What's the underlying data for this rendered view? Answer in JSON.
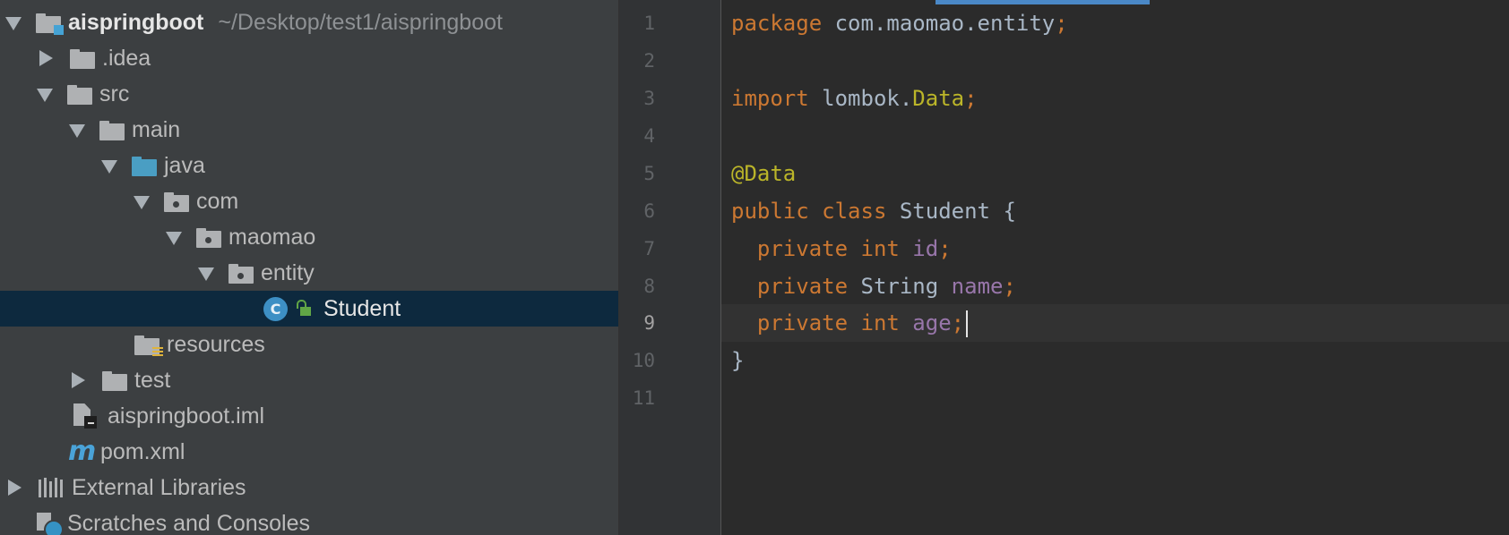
{
  "project_tree": {
    "root": {
      "label": "aispringboot",
      "path": "~/Desktop/test1/aispringboot"
    },
    "items": [
      {
        "label": ".idea"
      },
      {
        "label": "src"
      },
      {
        "label": "main"
      },
      {
        "label": "java"
      },
      {
        "label": "com"
      },
      {
        "label": "maomao"
      },
      {
        "label": "entity"
      },
      {
        "label": "Student",
        "selected": true,
        "class_icon_letter": "C"
      },
      {
        "label": "resources"
      },
      {
        "label": "test"
      },
      {
        "label": "aispringboot.iml"
      },
      {
        "label": "pom.xml",
        "icon_glyph": "m"
      },
      {
        "label": "External Libraries"
      },
      {
        "label": "Scratches and Consoles"
      }
    ]
  },
  "editor": {
    "current_line": 9,
    "line_numbers": [
      "1",
      "2",
      "3",
      "4",
      "5",
      "6",
      "7",
      "8",
      "9",
      "10",
      "11"
    ],
    "tokens": {
      "l1_kw": "package",
      "l1_rest": " com.maomao.entity",
      "l1_semi": ";",
      "l3_kw": "import",
      "l3_rest": " lombok.",
      "l3_ann": "Data",
      "l3_semi": ";",
      "l5_ann": "@Data",
      "l6_kw1": "public",
      "l6_kw2": " class",
      "l6_rest": " Student {",
      "l7_kw1": "private",
      "l7_kw2": " int",
      "l7_fld": " id",
      "l7_semi": ";",
      "l8_kw1": "private",
      "l8_type": " String",
      "l8_fld": " name",
      "l8_semi": ";",
      "l9_kw1": "private",
      "l9_kw2": " int",
      "l9_fld": " age",
      "l9_semi": ";",
      "l10": "}"
    }
  },
  "colors": {
    "keyword": "#cc7832",
    "annotation": "#bbb529",
    "field": "#9876aa",
    "plain": "#a9b7c6",
    "selection": "#0d293e"
  }
}
